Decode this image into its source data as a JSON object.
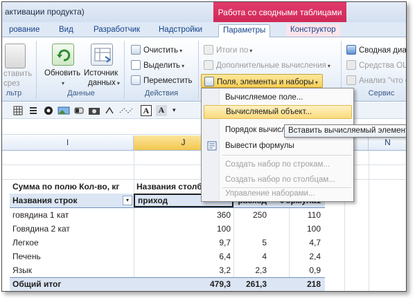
{
  "window": {
    "title_fragment": "активации продукта)",
    "contextual_group": "Работа со сводными таблицами",
    "accent": "#c8204f"
  },
  "tabs": [
    {
      "label": "рование"
    },
    {
      "label": "Вид"
    },
    {
      "label": "Разработчик"
    },
    {
      "label": "Надстройки"
    },
    {
      "label": "Параметры",
      "active": true
    },
    {
      "label": "Конструктор"
    }
  ],
  "ribbon": {
    "left_partial": {
      "line1": "ставить",
      "line2": "срез",
      "group_fragment": "льтр"
    },
    "data_group": {
      "label": "Данные",
      "refresh": {
        "line1": "Обновить"
      },
      "source": {
        "line1": "Источник",
        "line2": "данных"
      }
    },
    "actions_group": {
      "label": "Действия",
      "clear": "Очистить",
      "select": "Выделить",
      "move": "Переместить"
    },
    "calc_group": {
      "totals": "Итоги по",
      "additional": "Дополнительные вычисления",
      "fields": "Поля, элементы и наборы"
    },
    "service_group": {
      "label": "Сервис",
      "pivot_chart": "Сводная диаг",
      "olap": "Средства OLA",
      "whatif": "Анализ \"что е"
    }
  },
  "menu": {
    "items": [
      {
        "label": "Вычисляемое поле...",
        "enabled": true,
        "icon": "none"
      },
      {
        "label": "Вычисляемый объект...",
        "enabled": true,
        "highlighted": true,
        "icon": "none"
      },
      {
        "label": "Порядок вычисл",
        "enabled": true,
        "icon": "none"
      },
      {
        "label": "Вывести формулы",
        "enabled": true,
        "icon": "formula-list-icon"
      },
      {
        "label": "Создать набор по строкам...",
        "enabled": false,
        "icon": "none"
      },
      {
        "label": "Создать набор по столбцам...",
        "enabled": false,
        "icon": "none"
      },
      {
        "label": "Управление наборами...",
        "enabled": false,
        "icon": "none"
      }
    ]
  },
  "tooltip": "Вставить вычисляемый элемент",
  "columns": {
    "i": "I",
    "j": "J",
    "n": "N"
  },
  "pivot": {
    "value_caption": "Сумма по полю Кол-во, кг",
    "column_caption": "Названия столб",
    "row_caption": "Названия строк",
    "col1": "приход",
    "col2": "расход",
    "col3": "Формула1",
    "rows": [
      {
        "name": "говядина 1 кат",
        "v1": "360",
        "v2": "250",
        "v3": "110"
      },
      {
        "name": "Говядина 2 кат",
        "v1": "100",
        "v2": "",
        "v3": "100"
      },
      {
        "name": "Легкое",
        "v1": "9,7",
        "v2": "5",
        "v3": "4,7"
      },
      {
        "name": "Печень",
        "v1": "6,4",
        "v2": "4",
        "v3": "2,4"
      },
      {
        "name": "Язык",
        "v1": "3,2",
        "v2": "2,3",
        "v3": "0,9"
      }
    ],
    "total": {
      "name": "Общий итог",
      "v1": "479,3",
      "v2": "261,3",
      "v3": "218"
    }
  }
}
